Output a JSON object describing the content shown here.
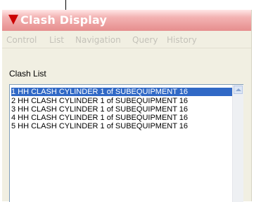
{
  "window": {
    "title": "Clash Display"
  },
  "menu": {
    "items": [
      "Control",
      "List",
      "Navigation",
      "Query",
      "History"
    ]
  },
  "clash_list": {
    "label": "Clash List",
    "rows": [
      "1  HH CLASH CYLINDER 1 of SUBEQUIPMENT 16",
      "2  HH CLASH CYLINDER 1 of SUBEQUIPMENT 16",
      "3  HH CLASH CYLINDER 1 of SUBEQUIPMENT 16",
      "4  HH CLASH CYLINDER 1 of SUBEQUIPMENT 16",
      "5  HH CLASH CYLINDER 1 of SUBEQUIPMENT 16"
    ],
    "selected_index": 0
  },
  "colors": {
    "selection": "#3169c6",
    "title_icon": "#cc0000",
    "menu_disabled_text": "#c4c2b9"
  },
  "icons": {
    "title": "app-triangle-icon",
    "scroll_up": "scroll-up-arrow-icon"
  }
}
